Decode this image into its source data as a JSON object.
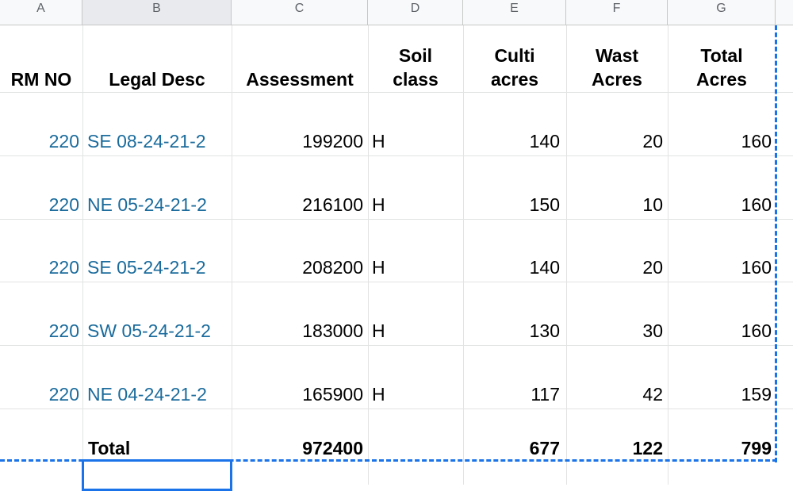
{
  "column_headers": [
    "A",
    "B",
    "C",
    "D",
    "E",
    "F",
    "G"
  ],
  "headers": {
    "rm_no": "RM NO",
    "legal_desc": "Legal Desc",
    "assessment": "Assessment",
    "soil_class_1": "Soil",
    "soil_class_2": "class",
    "culti_1": "Culti",
    "culti_2": "acres",
    "wast_1": "Wast",
    "wast_2": "Acres",
    "total_1": "Total",
    "total_2": "Acres"
  },
  "rows": [
    {
      "rm": "220",
      "legal": "SE 08-24-21-2",
      "assessment": "199200",
      "soil": "H",
      "culti": "140",
      "wast": "20",
      "total": "160"
    },
    {
      "rm": "220",
      "legal": "NE 05-24-21-2",
      "assessment": "216100",
      "soil": "H",
      "culti": "150",
      "wast": "10",
      "total": "160"
    },
    {
      "rm": "220",
      "legal": "SE 05-24-21-2",
      "assessment": "208200",
      "soil": "H",
      "culti": "140",
      "wast": "20",
      "total": "160"
    },
    {
      "rm": "220",
      "legal": "SW 05-24-21-2",
      "assessment": "183000",
      "soil": "H",
      "culti": "130",
      "wast": "30",
      "total": "160"
    },
    {
      "rm": "220",
      "legal": "NE 04-24-21-2",
      "assessment": "165900",
      "soil": "H",
      "culti": "117",
      "wast": "42",
      "total": "159"
    }
  ],
  "totals": {
    "label": "Total",
    "assessment": "972400",
    "culti": "677",
    "wast": "122",
    "total": "799"
  },
  "colors": {
    "link_text": "#1a6b9c",
    "selection": "#1a73e8"
  }
}
